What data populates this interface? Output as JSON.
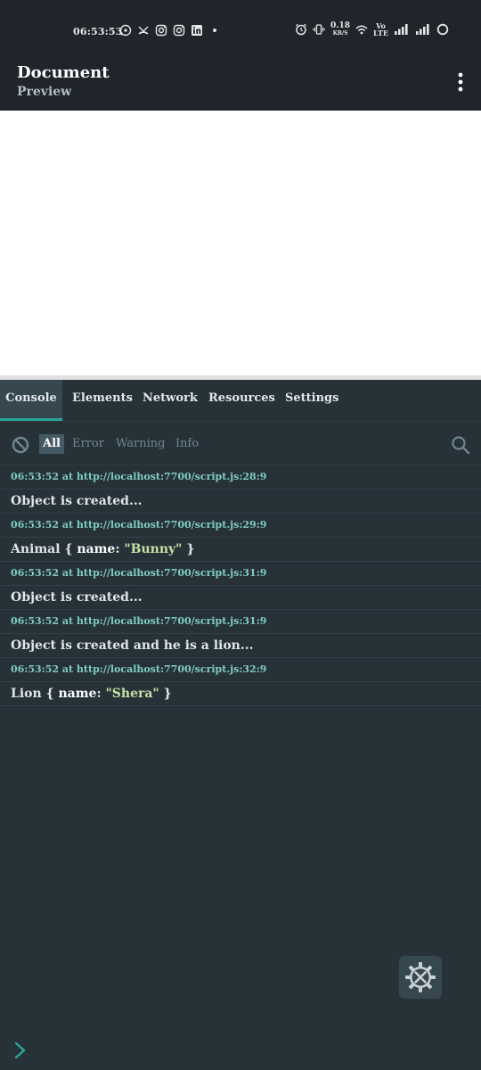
{
  "status_bar": {
    "time": "06:53:53",
    "speed_value": "0.18",
    "speed_unit": "KB/S",
    "volte_top": "Vo",
    "volte_bottom": "LTE"
  },
  "app_bar": {
    "title": "Document",
    "subtitle": "Preview"
  },
  "tabs": [
    {
      "label": "Console",
      "active": true
    },
    {
      "label": "Elements"
    },
    {
      "label": "Network"
    },
    {
      "label": "Resources"
    },
    {
      "label": "Settings"
    }
  ],
  "filters": [
    {
      "label": "All",
      "active": true
    },
    {
      "label": "Error"
    },
    {
      "label": "Warning"
    },
    {
      "label": "Info"
    }
  ],
  "logs": [
    {
      "meta": "06:53:52 at http://localhost:7700/script.js:28:9",
      "message": "Object is created..."
    },
    {
      "meta": "06:53:52 at http://localhost:7700/script.js:29:9",
      "obj": {
        "class": "Animal",
        "open": "{",
        "key": "name",
        "colon": ":",
        "value": "\"Bunny\"",
        "close": "}"
      }
    },
    {
      "meta": "06:53:52 at http://localhost:7700/script.js:31:9",
      "message": "Object is created..."
    },
    {
      "meta": "06:53:52 at http://localhost:7700/script.js:31:9",
      "message": "Object is created and he is a lion..."
    },
    {
      "meta": "06:53:52 at http://localhost:7700/script.js:32:9",
      "obj": {
        "class": "Lion",
        "open": "{",
        "key": "name",
        "colon": ":",
        "value": "\"Shera\"",
        "close": "}"
      }
    }
  ],
  "colors": {
    "accent": "#26a69a",
    "log_meta": "#80cbc4",
    "string_value": "#c5e1a5",
    "console_bg": "#263238",
    "app_bar_bg": "#1f252b"
  }
}
